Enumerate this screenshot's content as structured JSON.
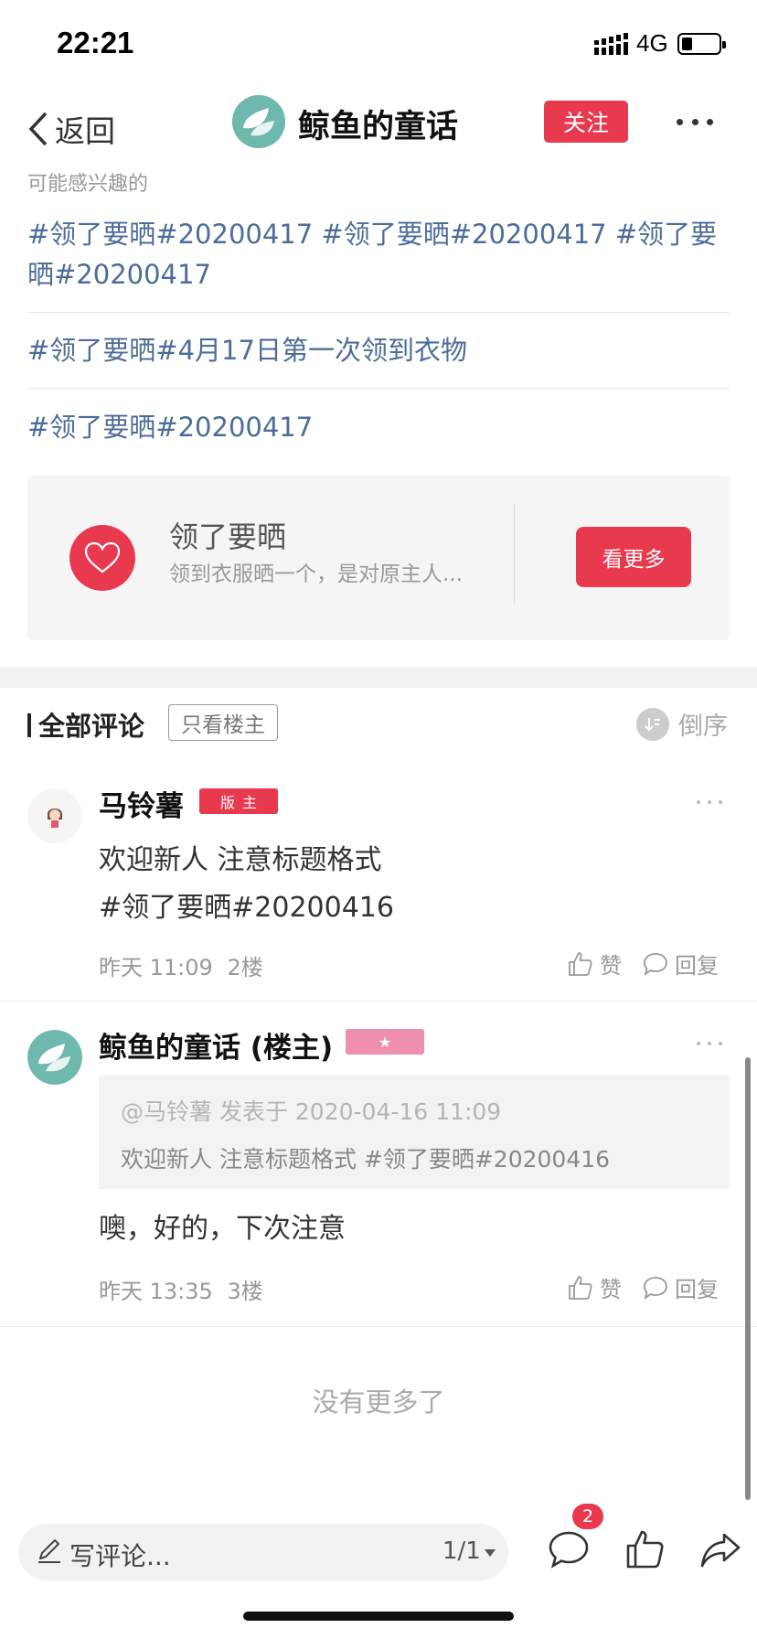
{
  "status_bar": {
    "time": "22:21",
    "network": "4G"
  },
  "nav": {
    "back_label": "返回",
    "title": "鲸鱼的童话",
    "follow_label": "关注"
  },
  "interest": {
    "label": "可能感兴趣的",
    "topics": [
      "#领了要晒#20200417 #领了要晒#20200417 #领了要晒#20200417",
      "#领了要晒#4月17日第一次领到衣物",
      "#领了要晒#20200417"
    ]
  },
  "topic_card": {
    "title": "领了要晒",
    "desc": "领到衣服晒一个，是对原主人...",
    "button": "看更多",
    "icon": "heart-icon"
  },
  "comments_header": {
    "title": "全部评论",
    "only_op": "只看楼主",
    "sort_label": "倒序"
  },
  "comments": [
    {
      "name": "马铃薯",
      "badge": "版主",
      "text": "欢迎新人 注意标题格式\n#领了要晒#20200416",
      "time": "昨天 11:09",
      "floor": "2楼",
      "like_label": "赞",
      "reply_label": "回复"
    },
    {
      "name": "鲸鱼的童话 (楼主)",
      "badge": "★",
      "quote_head": "@马铃薯 发表于 2020-04-16 11:09",
      "quote_body": "欢迎新人 注意标题格式 #领了要晒#20200416",
      "text": "噢，好的，下次注意",
      "time": "昨天 13:35",
      "floor": "3楼",
      "like_label": "赞",
      "reply_label": "回复"
    }
  ],
  "no_more": "没有更多了",
  "bottom_bar": {
    "write_placeholder": "写评论...",
    "page_indicator": "1/1",
    "comment_count": "2"
  },
  "colors": {
    "accent": "#e8394e",
    "topic_link": "#4d6c99",
    "avatar_teal": "#6fb8ae"
  }
}
